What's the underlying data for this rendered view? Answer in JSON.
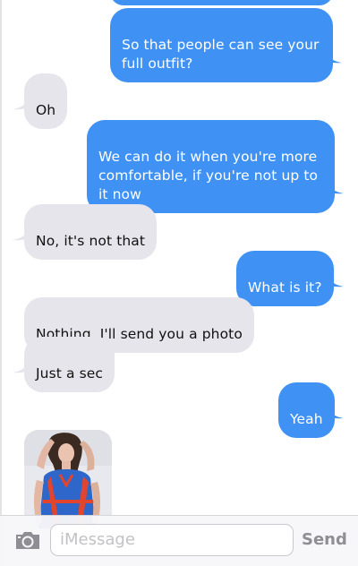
{
  "messages": [
    {
      "side": "sent",
      "text": "So that people can see your full outfit?"
    },
    {
      "side": "received",
      "text": "Oh"
    },
    {
      "side": "sent",
      "text": "We can do it when you're more comfortable, if you're not up to it now"
    },
    {
      "side": "received",
      "text": "No, it's not that"
    },
    {
      "side": "sent",
      "text": "What is it?"
    },
    {
      "side": "received",
      "text": "Nothing, I'll send you a photo"
    },
    {
      "side": "received",
      "text": "Just a sec"
    },
    {
      "side": "sent",
      "text": "Yeah"
    }
  ],
  "compose": {
    "placeholder": "iMessage",
    "send_label": "Send",
    "camera_icon": "camera-icon"
  },
  "colors": {
    "sent_bubble": "#3f92f4",
    "received_bubble": "#e6e5eb",
    "send_disabled": "#8e8e93"
  }
}
